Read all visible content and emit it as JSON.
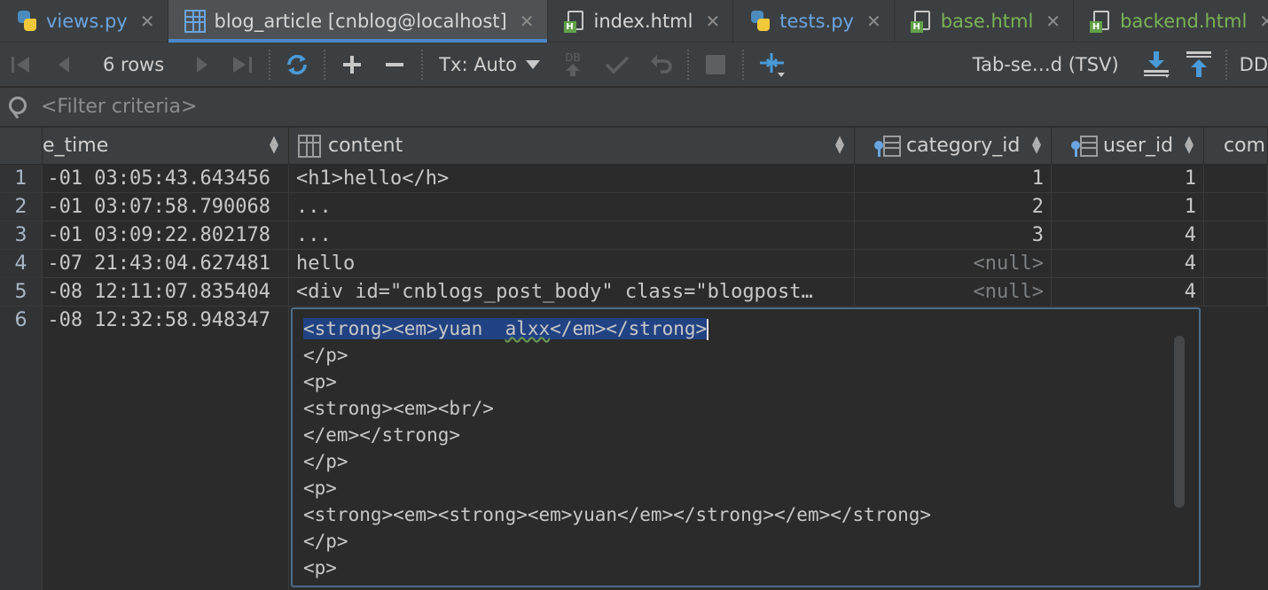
{
  "tabs": [
    {
      "label": "views.py",
      "icon": "python-file-icon"
    },
    {
      "label": "blog_article [cnblog@localhost]",
      "icon": "table-icon",
      "active": true
    },
    {
      "label": "index.html",
      "icon": "html-file-icon"
    },
    {
      "label": "tests.py",
      "icon": "python-file-icon"
    },
    {
      "label": "base.html",
      "icon": "html-file-icon"
    },
    {
      "label": "backend.html",
      "icon": "html-file-icon"
    }
  ],
  "tab_close_glyph": "✕",
  "toolbar": {
    "rows_label": "6 rows",
    "tx_label": "Tx: Auto",
    "db_badge": "DB",
    "export_format": "Tab-se…d (TSV)",
    "overflow_label": "DD"
  },
  "filter": {
    "placeholder": "<Filter criteria>"
  },
  "columns": {
    "time": "e_time",
    "content": "content",
    "category_id": "category_id",
    "user_id": "user_id",
    "comment": "comm"
  },
  "rows": [
    {
      "num": "1",
      "time": "-01 03:05:43.643456",
      "content": "<h1>hello</h>",
      "category_id": "1",
      "user_id": "1"
    },
    {
      "num": "2",
      "time": "-01 03:07:58.790068",
      "content": "...",
      "category_id": "2",
      "user_id": "1"
    },
    {
      "num": "3",
      "time": "-01 03:09:22.802178",
      "content": "...",
      "category_id": "3",
      "user_id": "4"
    },
    {
      "num": "4",
      "time": "-07 21:43:04.627481",
      "content": "hello",
      "category_id": "<null>",
      "user_id": "4"
    },
    {
      "num": "5",
      "time": "-08 12:11:07.835404",
      "content": "<div id=\"cnblogs_post_body\" class=\"blogpost…",
      "category_id": "<null>",
      "user_id": "4"
    },
    {
      "num": "6",
      "time": "-08 12:32:58.948347",
      "content": "",
      "category_id": "",
      "user_id": ""
    }
  ],
  "editor": {
    "line0_a": "<strong><em>yuan  ",
    "line0_b": "alxx",
    "line0_c": "</em></strong>",
    "lines": [
      "</p>",
      "<p>",
      "<strong><em><br/>",
      "</em></strong>",
      "</p>",
      "<p>",
      "<strong><em><strong><em>yuan</em></strong></em></strong>",
      "</p>",
      "<p>"
    ]
  },
  "colors": {
    "accent": "#4a88c7",
    "selection": "#214283",
    "background": "#2b2b2b"
  }
}
